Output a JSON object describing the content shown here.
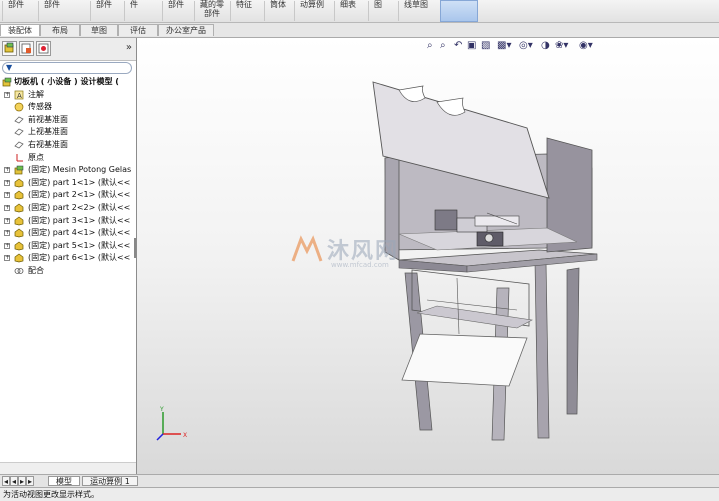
{
  "ribbon": {
    "items": [
      "部件",
      "部件",
      "部件",
      "件",
      "部件",
      "藏的零\n部件",
      "特征",
      "筒体",
      "动算例",
      "细表",
      "图",
      "线草图"
    ]
  },
  "tabs": [
    "装配体",
    "布局",
    "草图",
    "评估",
    "办公室产品"
  ],
  "left_panel": {
    "collapse_label": "»",
    "filter_label": "▼"
  },
  "tree": [
    {
      "level": 0,
      "expander": "",
      "icon": "assembly",
      "label": "切板机 ( 小设备 ) 设计模型  (",
      "bold": true
    },
    {
      "level": 1,
      "expander": "+",
      "icon": "annotation",
      "label": "注解"
    },
    {
      "level": 1,
      "expander": "",
      "icon": "sensor",
      "label": "传感器"
    },
    {
      "level": 1,
      "expander": "",
      "icon": "plane",
      "label": "前视基准面"
    },
    {
      "level": 1,
      "expander": "",
      "icon": "plane",
      "label": "上视基准面"
    },
    {
      "level": 1,
      "expander": "",
      "icon": "plane",
      "label": "右视基准面"
    },
    {
      "level": 1,
      "expander": "",
      "icon": "origin",
      "label": "原点"
    },
    {
      "level": 1,
      "expander": "+",
      "icon": "subassembly",
      "label": "(固定) Mesin Potong Gelas"
    },
    {
      "level": 1,
      "expander": "+",
      "icon": "part",
      "label": "(固定) part 1<1> (默认<<"
    },
    {
      "level": 1,
      "expander": "+",
      "icon": "part",
      "label": "(固定) part 2<1> (默认<<"
    },
    {
      "level": 1,
      "expander": "+",
      "icon": "part",
      "label": "(固定) part 2<2> (默认<<"
    },
    {
      "level": 1,
      "expander": "+",
      "icon": "part",
      "label": "(固定) part 3<1> (默认<<"
    },
    {
      "level": 1,
      "expander": "+",
      "icon": "part",
      "label": "(固定) part 4<1> (默认<<"
    },
    {
      "level": 1,
      "expander": "+",
      "icon": "part",
      "label": "(固定) part 5<1> (默认<<"
    },
    {
      "level": 1,
      "expander": "+",
      "icon": "part",
      "label": "(固定) part 6<1> (默认<<"
    },
    {
      "level": 1,
      "expander": "",
      "icon": "mates",
      "label": "配合"
    }
  ],
  "watermark": {
    "text": "沐风网",
    "url": "www.mfcad.com"
  },
  "bottom_tabs": [
    "模型",
    "运动算例 1"
  ],
  "status": "为活动视图更改显示样式。",
  "colors": {
    "accent": "#86a7d6",
    "part_yellow": "#e8c23a",
    "watermark": "#e87a2c",
    "model_gray": "#a7a3ad"
  }
}
